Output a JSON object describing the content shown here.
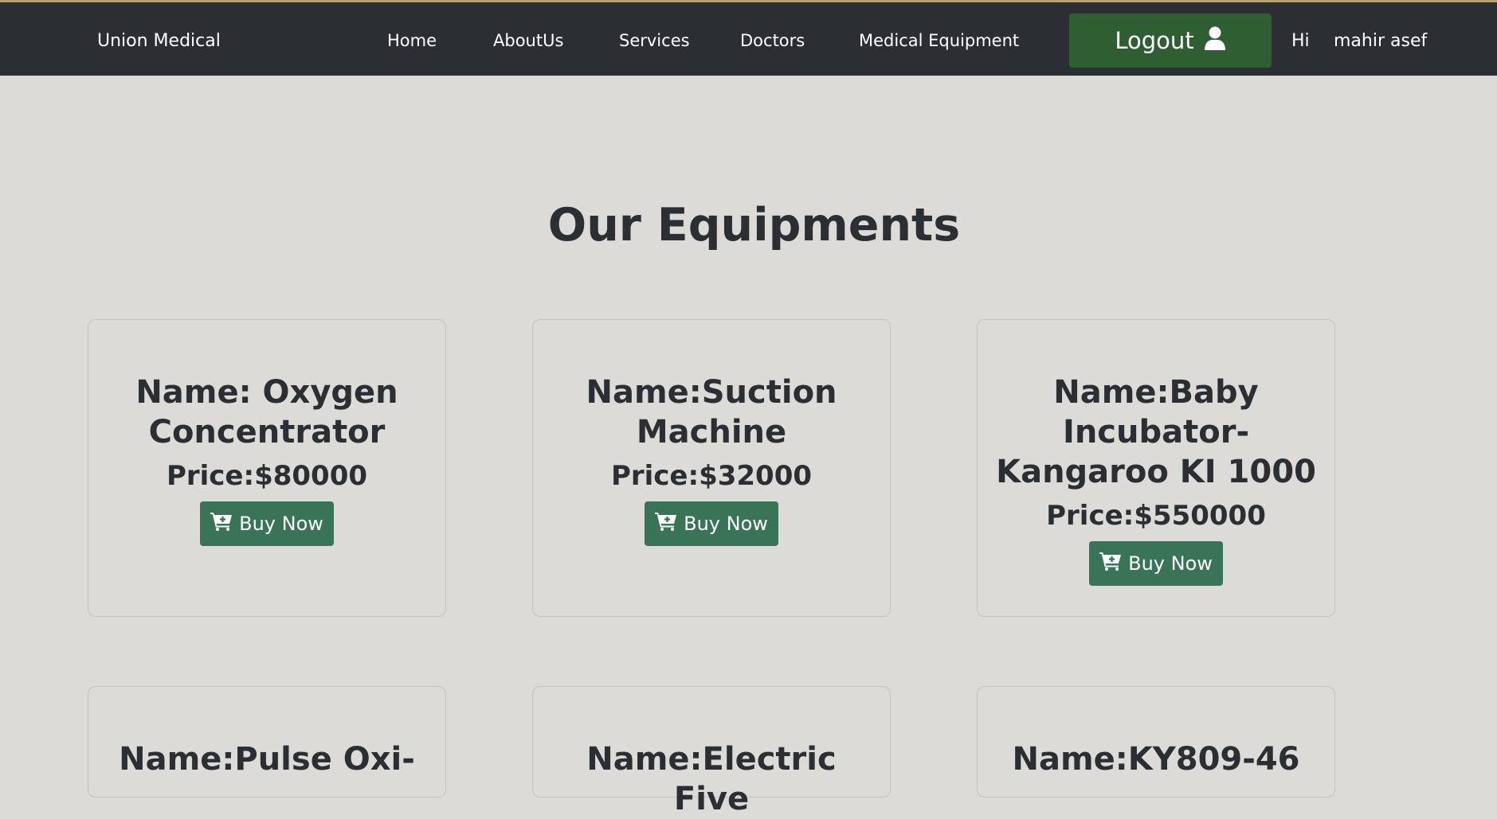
{
  "navbar": {
    "brand": "Union Medical",
    "links": [
      "Home",
      "AboutUs",
      "Services",
      "Doctors",
      "Medical Equipment"
    ],
    "logout_label": "Logout",
    "greeting": "Hi",
    "username": "mahir asef",
    "logout_color": "#2f5e32",
    "background": "#2b2f33"
  },
  "main": {
    "title": "Our Equipments",
    "buy_label": "Buy Now",
    "buy_color": "#397459",
    "cards": [
      {
        "name": "Name: Oxygen Concentrator",
        "price": "Price:$80000"
      },
      {
        "name": "Name:Suction Machine",
        "price": "Price:$32000"
      },
      {
        "name": "Name:Baby Incubator-Kangaroo KI 1000",
        "price": "Price:$550000"
      },
      {
        "name": "Name:Pulse Oxi-",
        "price": ""
      },
      {
        "name": "Name:Electric Five",
        "price": ""
      },
      {
        "name": "Name:KY809-46",
        "price": ""
      }
    ]
  },
  "icons": {
    "user": "user-icon",
    "cart": "cart-plus-icon"
  }
}
